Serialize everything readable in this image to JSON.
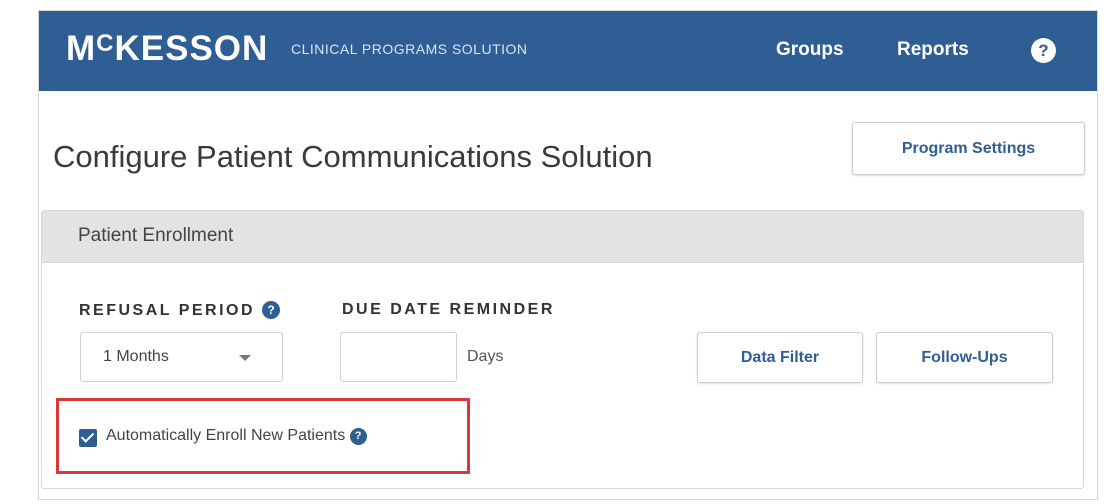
{
  "navbar": {
    "brand_main": "MCKESSON",
    "brand_sub": "CLINICAL PROGRAMS SOLUTION",
    "links": [
      "Groups",
      "Reports"
    ],
    "help_icon": "question-circle-icon",
    "help_label": "?",
    "color": "#2e5e94"
  },
  "page": {
    "title": "Configure Patient Communications Solution",
    "program_settings_label": "Program Settings"
  },
  "enrollment": {
    "header": "Patient Enrollment",
    "refusal_label": "REFUSAL PERIOD",
    "refusal_value": "1 Months",
    "due_date_label": "DUE DATE REMINDER",
    "due_date_value": "",
    "days_label": "Days",
    "data_filter_label": "Data Filter",
    "follow_ups_label": "Follow-Ups",
    "auto_enroll_label": "Automatically Enroll New Patients",
    "auto_enroll_checked": true,
    "info_icon": "info-circle-icon",
    "info_glyph": "?"
  },
  "colors": {
    "accent": "#2e5e94",
    "highlight": "#d93838",
    "panel_header": "#e3e3e3"
  }
}
